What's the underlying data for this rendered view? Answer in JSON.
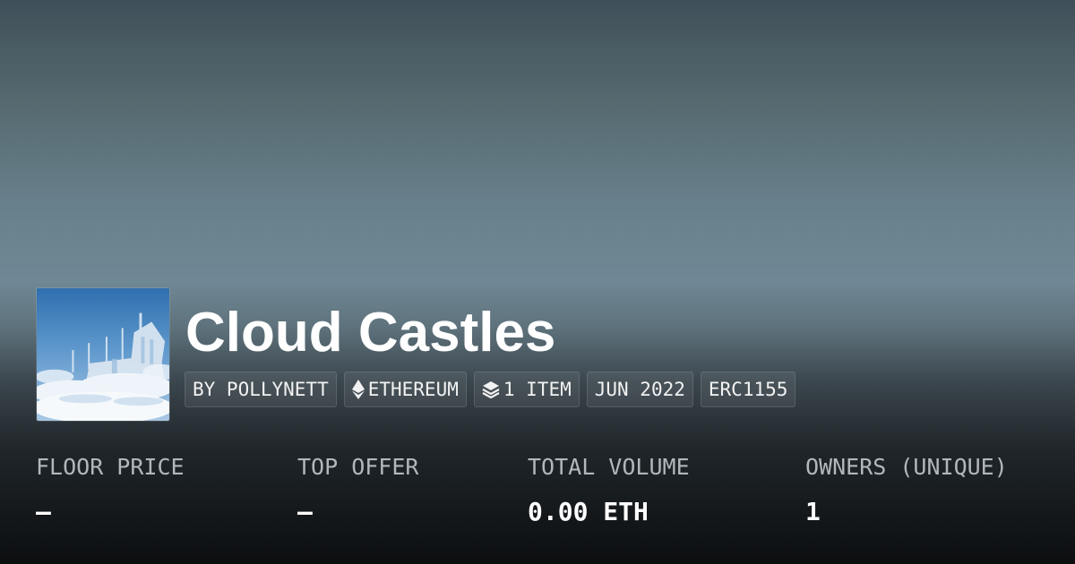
{
  "collection": {
    "title": "Cloud Castles",
    "thumbnail_icon": "cloud-castles-artwork"
  },
  "tags": {
    "creator": "BY POLLYNETT",
    "chain": "ETHEREUM",
    "chain_icon": "ethereum-icon",
    "items": "1 ITEM",
    "items_icon": "layers-icon",
    "date": "JUN 2022",
    "standard": "ERC1155"
  },
  "stats": [
    {
      "label": "FLOOR PRICE",
      "value": "—"
    },
    {
      "label": "TOP OFFER",
      "value": "—"
    },
    {
      "label": "TOTAL VOLUME",
      "value": "0.00 ETH"
    },
    {
      "label": "OWNERS (UNIQUE)",
      "value": "1"
    }
  ],
  "colors": {
    "text_primary": "#ffffff",
    "text_muted": "#b2b7bc",
    "tag_background": "rgba(255,255,255,0.07)"
  }
}
